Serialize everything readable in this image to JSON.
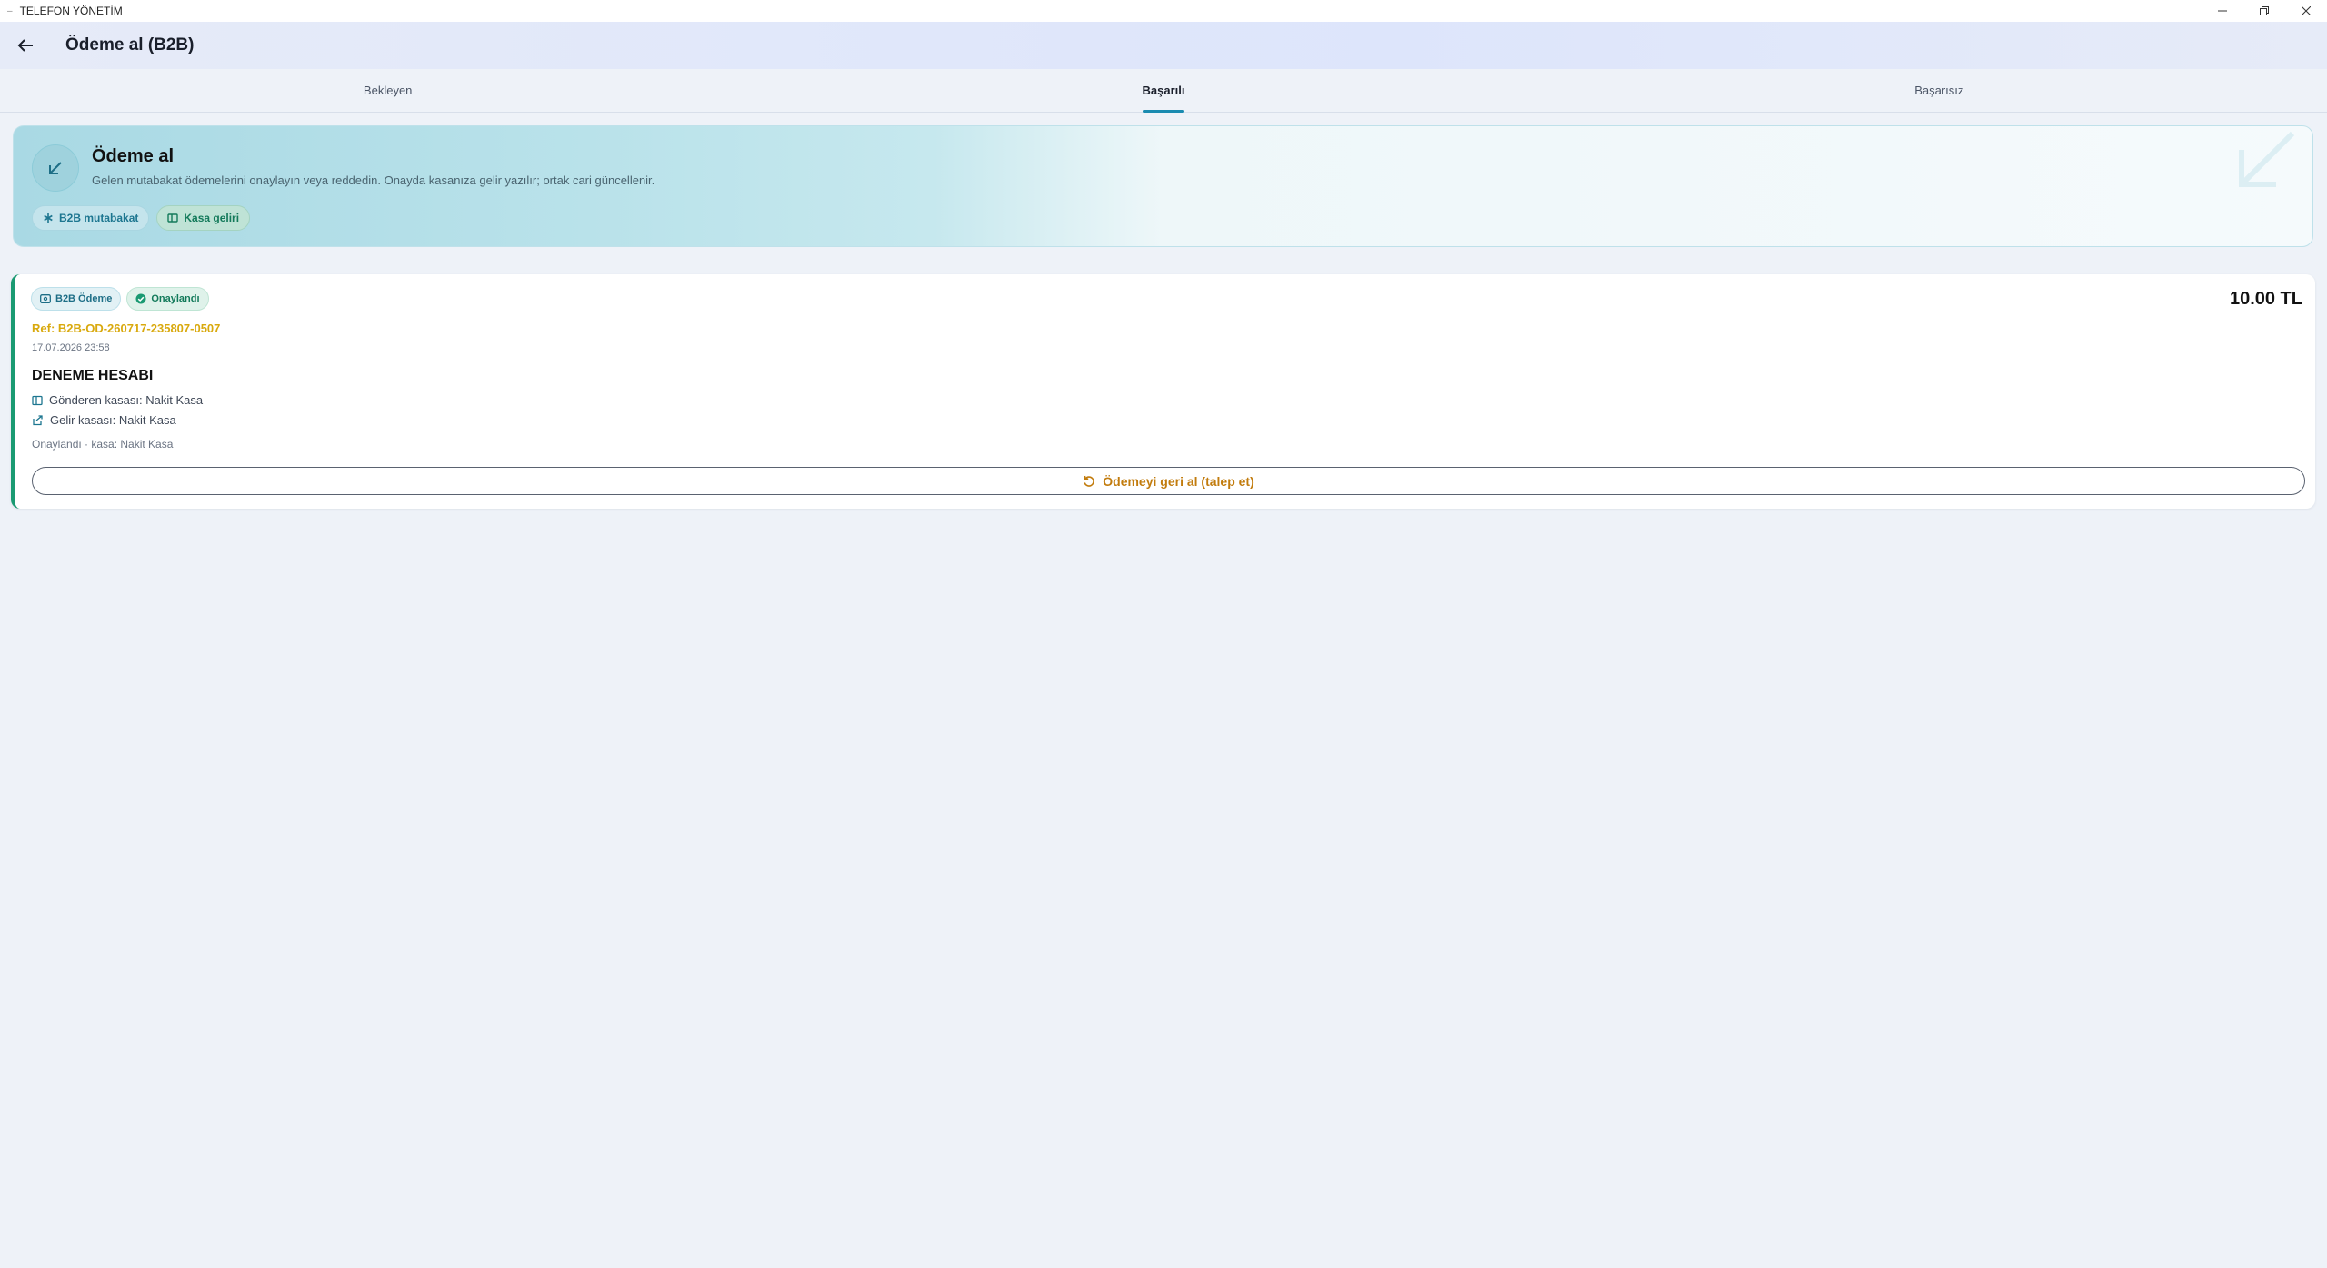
{
  "window": {
    "title": "TELEFON YÖNETİM"
  },
  "appbar": {
    "title": "Ödeme al (B2B)"
  },
  "tabs": [
    {
      "label": "Bekleyen",
      "active": false
    },
    {
      "label": "Başarılı",
      "active": true
    },
    {
      "label": "Başarısız",
      "active": false
    }
  ],
  "hero": {
    "title": "Ödeme al",
    "description": "Gelen mutabakat ödemelerini onaylayın veya reddedin. Onayda kasanıza gelir yazılır; ortak cari güncellenir.",
    "chips": [
      "B2B mutabakat",
      "Kasa geliri"
    ]
  },
  "transaction": {
    "type_badge": "B2B Ödeme",
    "status_badge": "Onaylandı",
    "amount": "10.00 TL",
    "ref": "Ref: B2B-OD-260717-235807-0507",
    "date": "17.07.2026 23:58",
    "account": "DENEME HESABI",
    "sender_cashbox": "Gönderen kasası: Nakit Kasa",
    "income_cashbox": "Gelir kasası: Nakit Kasa",
    "note": "Onaylandı · kasa: Nakit Kasa",
    "revert_label": "Ödemeyi geri al (talep et)"
  },
  "colors": {
    "accent": "#1a8bb0",
    "success": "#1a9a72",
    "ref": "#d9a90d",
    "revert": "#c27c0e"
  }
}
